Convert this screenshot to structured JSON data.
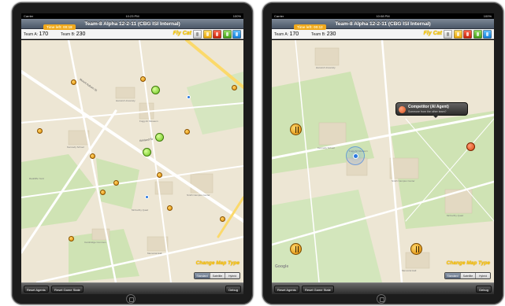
{
  "screens": [
    {
      "status": {
        "carrier": "Carrier",
        "time": "10:23 PM",
        "battery": "100%"
      },
      "nav_title": "Team-8 Alpha 12-2-11 (CBG ISI Internal)",
      "scorebar": {
        "time_left": "Time left: 00:18",
        "team_a_label": "Team A:",
        "team_a_score": "170",
        "team_b_label": "Team B:",
        "team_b_score": "230",
        "logo": "Fly Cat"
      },
      "map_labels": {
        "street_1": "Mount Auburn St",
        "street_2": "Kirkland St",
        "bldg_1": "Harvard University",
        "bldg_2": "Kennedy School",
        "bldg_3": "Fogg Art Museum",
        "bldg_4": "Smith Campus Center",
        "bldg_5": "McCarthy Quad",
        "bldg_6": "Radcliffe Yard",
        "bldg_7": "Cambridge Common",
        "bldg_8": "Memorial Hall"
      },
      "change_map_type": "Change Map Type",
      "map_types": [
        "Standard",
        "Satellite",
        "Hybrid"
      ],
      "toolbar": {
        "reset_agents": "Reset Agents",
        "reset_game": "Reset Game State",
        "debug": "Debug"
      }
    },
    {
      "status": {
        "carrier": "Carrier",
        "time": "10:08 PM",
        "battery": "100%"
      },
      "nav_title": "Team-8 Alpha 12-2-11 (CBG ISI Internal)",
      "scorebar": {
        "time_left": "Time left: 00:12",
        "team_a_label": "Team A:",
        "team_a_score": "170",
        "team_b_label": "Team B:",
        "team_b_score": "230",
        "logo": "Fly Cat"
      },
      "callout": {
        "title": "Competitor (AI Agent)",
        "subtitle": "Someone from the other team?"
      },
      "map_labels": {
        "bldg_1": "Harvard University",
        "bldg_2": "Kennedy School",
        "bldg_3": "Fogg Art Museum",
        "bldg_4": "McCarthy Quad",
        "bldg_5": "Smith Campus Center",
        "bldg_6": "Memorial Hall"
      },
      "google": "Google",
      "change_map_type": "Change Map Type",
      "map_types": [
        "Standard",
        "Satellite",
        "Hybrid"
      ],
      "toolbar": {
        "reset_agents": "Reset Agents",
        "reset_game": "Reset Game State",
        "debug": "Debug"
      }
    }
  ]
}
